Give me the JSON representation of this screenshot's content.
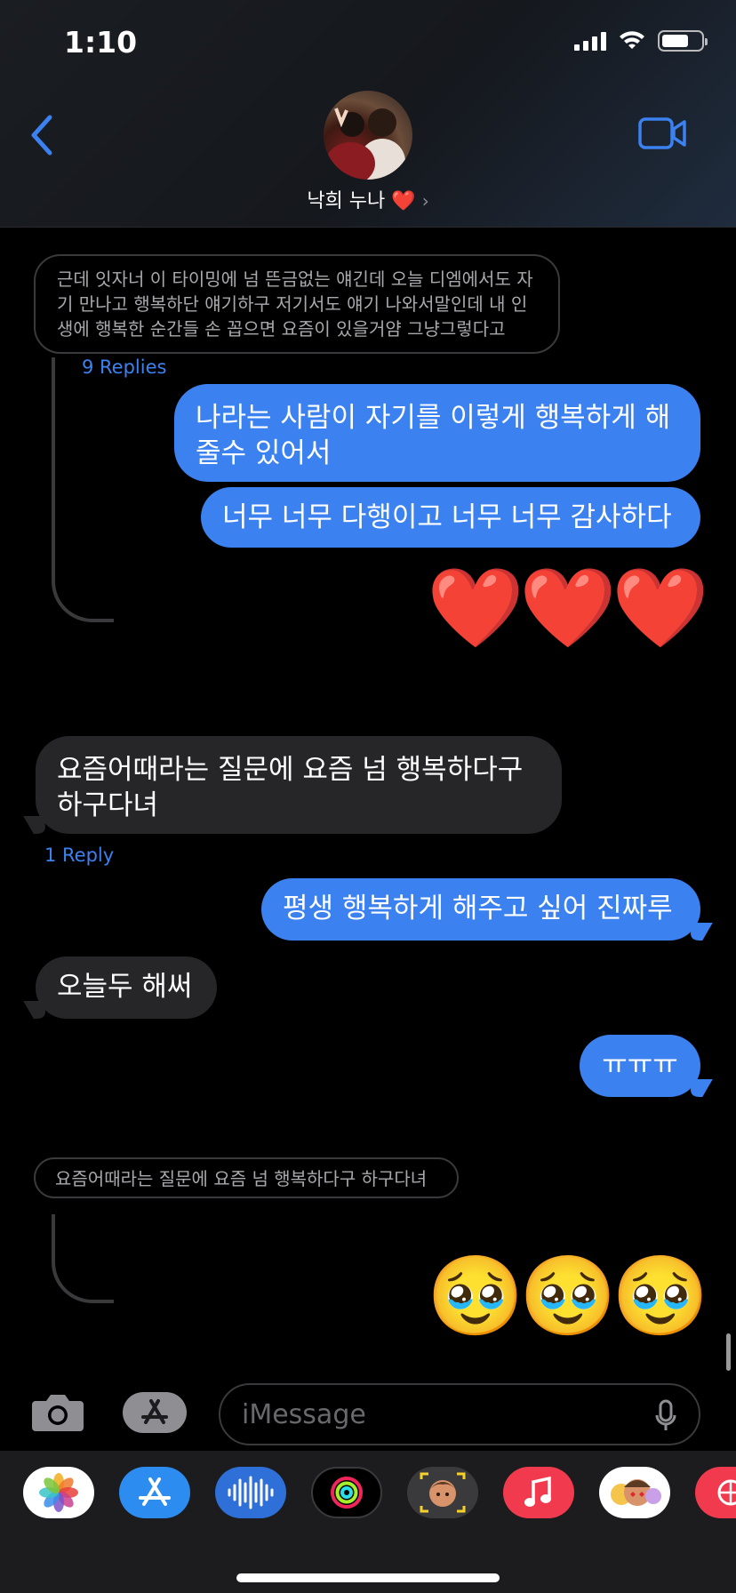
{
  "status": {
    "time": "1:10"
  },
  "header": {
    "contact_name": "낙희 누나",
    "heart": "❤️",
    "chevron": "›"
  },
  "messages": {
    "quote1": "근데 잇자너 이 타이밍에 넘 뜬금없는 얘긴데 오늘 디엠에서도 자기 만나고 행복하단 얘기하구 저기서도 얘기 나와서말인데 내 인생에 행복한 순간들 손 꼽으면 요즘이 있을거얌 그냥그렇다고",
    "replies1": "9 Replies",
    "sent1": "나라는 사람이 자기를 이렇게 행복하게 해 줄수 있어서",
    "sent2": "너무 너무 다행이고 너무 너무 감사하다",
    "hearts": [
      "❤️",
      "❤️",
      "❤️"
    ],
    "recv1": "요즘어때라는 질문에 요즘 넘 행복하다구 하구다녀",
    "replies2": "1 Reply",
    "sent3": "평생 행복하게 해주고 싶어 진짜루",
    "recv2": "오늘두 해써",
    "sent4": "ㅠㅠㅠ",
    "quote2": "요즘어때라는 질문에 요즘 넘 행복하다구 하구다녀",
    "pleading": [
      "🥹",
      "🥹",
      "🥹"
    ]
  },
  "input": {
    "placeholder": "iMessage"
  },
  "apps": [
    "photos",
    "app-store",
    "audio-messages",
    "activity",
    "memoji",
    "music",
    "memoji-stickers",
    "digital-touch"
  ],
  "colors": {
    "sent_bubble": "#3b82f0",
    "received_bubble": "#262628",
    "accent": "#3b82f0"
  }
}
